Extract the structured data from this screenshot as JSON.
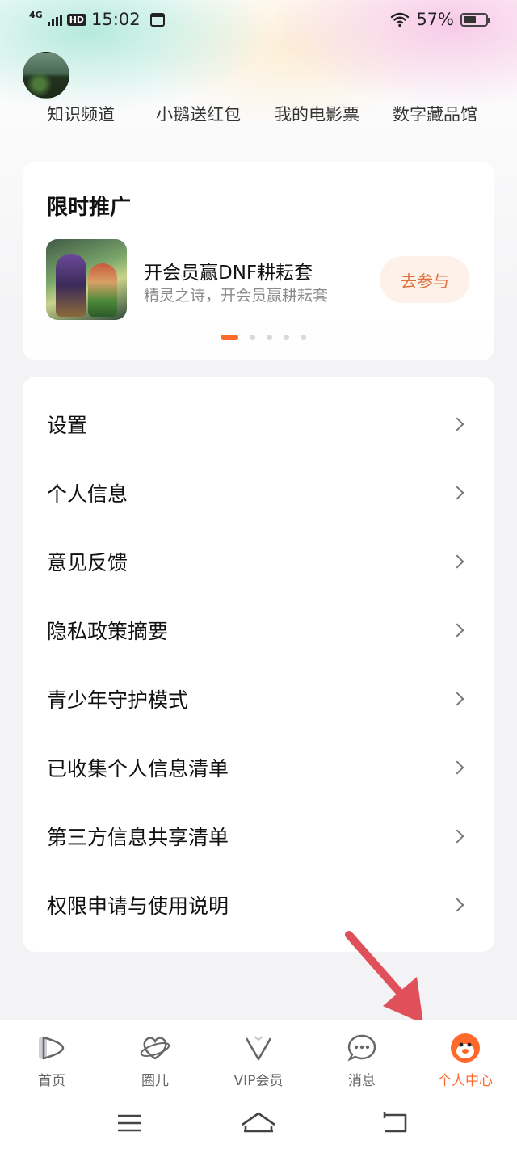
{
  "status_bar": {
    "network": "4G",
    "hd": "HD",
    "time": "15:02",
    "battery_percent": "57%",
    "battery_level": 0.57
  },
  "quick_links": [
    "知识频道",
    "小鹅送红包",
    "我的电影票",
    "数字藏品馆"
  ],
  "promo": {
    "title": "限时推广",
    "item_name": "开会员赢DNF耕耘套",
    "item_desc": "精灵之诗，开会员赢耕耘套",
    "button_label": "去参与",
    "pages": 5,
    "active_page": 0
  },
  "menu": [
    {
      "label": "设置"
    },
    {
      "label": "个人信息"
    },
    {
      "label": "意见反馈"
    },
    {
      "label": "隐私政策摘要"
    },
    {
      "label": "青少年守护模式"
    },
    {
      "label": "已收集个人信息清单"
    },
    {
      "label": "第三方信息共享清单"
    },
    {
      "label": "权限申请与使用说明"
    }
  ],
  "tabs": [
    {
      "label": "首页",
      "icon": "home-play-icon"
    },
    {
      "label": "圈儿",
      "icon": "circle-icon"
    },
    {
      "label": "VIP会员",
      "icon": "vip-icon"
    },
    {
      "label": "消息",
      "icon": "message-icon"
    },
    {
      "label": "个人中心",
      "icon": "profile-icon",
      "active": true
    }
  ],
  "colors": {
    "accent": "#ff6a2c",
    "annotation_arrow": "#e0505a"
  }
}
